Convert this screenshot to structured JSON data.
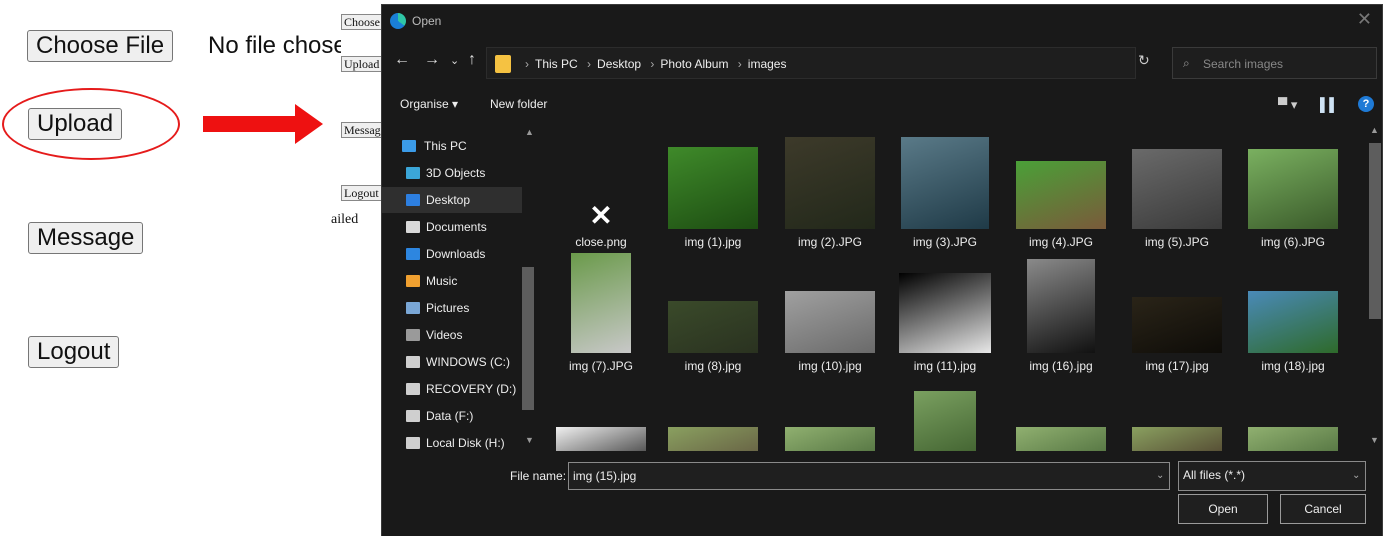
{
  "bg": {
    "choose_file": "Choose File",
    "no_file": "No file chosen",
    "upload": "Upload",
    "message": "Message",
    "logout": "Logout",
    "mini_choose": "Choose",
    "mini_upload": "Upload",
    "mini_message": "Message",
    "mini_logout": "Logout",
    "mini_failed": "ailed"
  },
  "dialog": {
    "title": "Open",
    "close": "✕",
    "nav": {
      "back": "←",
      "forward": "→",
      "recent": "⌄",
      "up": "↑",
      "refresh": "↻",
      "dropdown": "⌄"
    },
    "breadcrumb": [
      "This PC",
      "Desktop",
      "Photo Album",
      "images"
    ],
    "search_placeholder": "Search images",
    "toolbar": {
      "organise": "Organise ▾",
      "new_folder": "New folder",
      "view": "▀ ▾",
      "pane": "▌▌",
      "help": "?"
    },
    "sidebar": [
      {
        "label": "This PC",
        "icon": "monitor-icon",
        "color": "#3b9be8",
        "selected": false
      },
      {
        "label": "3D Objects",
        "icon": "cube-icon",
        "color": "#3ba6d8",
        "selected": false
      },
      {
        "label": "Desktop",
        "icon": "desktop-icon",
        "color": "#2d7fe0",
        "selected": true
      },
      {
        "label": "Documents",
        "icon": "document-icon",
        "color": "#d9d9d9",
        "selected": false
      },
      {
        "label": "Downloads",
        "icon": "download-icon",
        "color": "#2d86e0",
        "selected": false
      },
      {
        "label": "Music",
        "icon": "music-icon",
        "color": "#f0a030",
        "selected": false
      },
      {
        "label": "Pictures",
        "icon": "pictures-icon",
        "color": "#7aa7d6",
        "selected": false
      },
      {
        "label": "Videos",
        "icon": "videos-icon",
        "color": "#9a9a9a",
        "selected": false
      },
      {
        "label": "WINDOWS (C:)",
        "icon": "drive-c-icon",
        "color": "#cfcfcf",
        "selected": false
      },
      {
        "label": "RECOVERY (D:)",
        "icon": "drive-icon",
        "color": "#cfcfcf",
        "selected": false
      },
      {
        "label": "Data (F:)",
        "icon": "drive-icon",
        "color": "#cfcfcf",
        "selected": false
      },
      {
        "label": "Local Disk (H:)",
        "icon": "drive-icon",
        "color": "#cfcfcf",
        "selected": false
      }
    ],
    "files_row1": [
      {
        "name": "close.png",
        "icon": "x-icon",
        "colors": [
          "#191919",
          "#191919"
        ]
      },
      {
        "name": "img (1).jpg",
        "colors": [
          "#3f8a2a",
          "#1d4d12"
        ]
      },
      {
        "name": "img (2).JPG",
        "colors": [
          "#3d3a2a",
          "#22281a"
        ]
      },
      {
        "name": "img (3).JPG",
        "colors": [
          "#5a7a88",
          "#1f3a47"
        ]
      },
      {
        "name": "img (4).JPG",
        "colors": [
          "#4aa038",
          "#7a5a3a"
        ]
      },
      {
        "name": "img (5).JPG",
        "colors": [
          "#6a6a6a",
          "#3a3a3a"
        ]
      },
      {
        "name": "img (6).JPG",
        "colors": [
          "#7ab060",
          "#3a5a2a"
        ]
      }
    ],
    "files_row2": [
      {
        "name": "img (7).JPG",
        "colors": [
          "#6a9a4a",
          "#c8c8c8"
        ]
      },
      {
        "name": "img (8).jpg",
        "colors": [
          "#3a4a2a",
          "#2a3220"
        ]
      },
      {
        "name": "img (10).jpg",
        "colors": [
          "#a0a0a0",
          "#6a6a6a"
        ]
      },
      {
        "name": "img (11).jpg",
        "colors": [
          "#000000",
          "#e8e8e8"
        ]
      },
      {
        "name": "img (16).jpg",
        "colors": [
          "#8a8a8a",
          "#111111"
        ]
      },
      {
        "name": "img (17).jpg",
        "colors": [
          "#2a2418",
          "#0e0c08"
        ]
      },
      {
        "name": "img (18).jpg",
        "colors": [
          "#4a8ab8",
          "#2e6a2a"
        ]
      }
    ],
    "files_row3": [
      {
        "name": "",
        "colors": [
          "#f0f0f0",
          "#222222"
        ]
      },
      {
        "name": "",
        "colors": [
          "#8aa060",
          "#5a4a3a"
        ]
      },
      {
        "name": "",
        "colors": [
          "#90b070",
          "#4a6a3a"
        ]
      },
      {
        "name": "",
        "colors": [
          "#7aa060",
          "#3a5a2a"
        ]
      },
      {
        "name": "",
        "colors": [
          "#90b070",
          "#4a6a3a"
        ]
      },
      {
        "name": "",
        "colors": [
          "#8aa060",
          "#4a3a2a"
        ]
      },
      {
        "name": "",
        "colors": [
          "#90b070",
          "#4a6a3a"
        ]
      }
    ],
    "file_name_label": "File name:",
    "file_name_value": "img (15).jpg",
    "file_type": "All files (*.*)",
    "open_label": "Open",
    "cancel_label": "Cancel"
  }
}
